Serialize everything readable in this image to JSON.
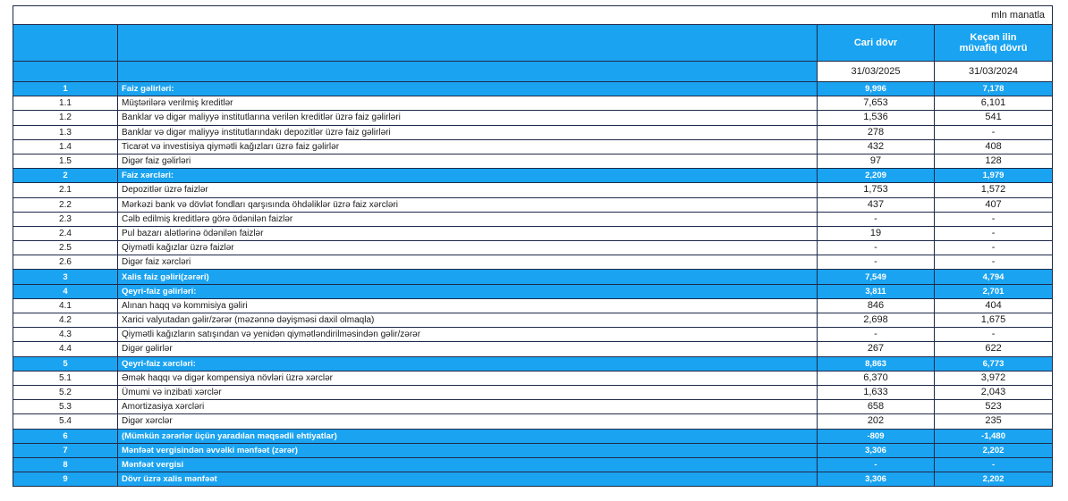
{
  "unit_label": "mln manatla",
  "columns": {
    "current": "Cari dövr",
    "previous_line1": "Keçən ilin",
    "previous_line2": "müvafiq dövrü"
  },
  "dates": {
    "current": "31/03/2025",
    "previous": "31/03/2024"
  },
  "rows": [
    {
      "num": "1",
      "label": "Faiz gəlirləri:",
      "cur": "9,996",
      "prev": "7,178",
      "section": true
    },
    {
      "num": "1.1",
      "label": "Müştərilərə verilmiş kreditlər",
      "cur": "7,653",
      "prev": "6,101",
      "section": false
    },
    {
      "num": "1.2",
      "label": "Banklar və digər maliyyə institutlarına verilən kreditlər üzrə faiz gəlirləri",
      "cur": "1,536",
      "prev": "541",
      "section": false
    },
    {
      "num": "1.3",
      "label": "Banklar və digər maliyyə institutlarındakı depozitlər üzrə faiz gəlirləri",
      "cur": "278",
      "prev": "-",
      "section": false
    },
    {
      "num": "1.4",
      "label": "Ticarət və investisiya qiymətli kağızları üzrə faiz gəlirlər",
      "cur": "432",
      "prev": "408",
      "section": false
    },
    {
      "num": "1.5",
      "label": "Digər faiz gəlirləri",
      "cur": "97",
      "prev": "128",
      "section": false
    },
    {
      "num": "2",
      "label": "Faiz xərcləri:",
      "cur": "2,209",
      "prev": "1,979",
      "section": true
    },
    {
      "num": "2.1",
      "label": "Depozitlər üzrə faizlər",
      "cur": "1,753",
      "prev": "1,572",
      "section": false
    },
    {
      "num": "2.2",
      "label": "Mərkəzi bank və dövlət fondları qarşısında öhdəliklər üzrə faiz xərcləri",
      "cur": "437",
      "prev": "407",
      "section": false
    },
    {
      "num": "2.3",
      "label": "Cəlb edilmiş kreditlərə görə ödənilən faizlər",
      "cur": "-",
      "prev": "-",
      "section": false
    },
    {
      "num": "2.4",
      "label": "Pul bazarı alətlərinə ödənilən faizlər",
      "cur": "19",
      "prev": "-",
      "section": false
    },
    {
      "num": "2.5",
      "label": "Qiymətli kağızlar üzrə faizlər",
      "cur": "-",
      "prev": "-",
      "section": false
    },
    {
      "num": "2.6",
      "label": "Digər faiz xərcləri",
      "cur": "-",
      "prev": "-",
      "section": false
    },
    {
      "num": "3",
      "label": "Xalis faiz gəliri(zərəri)",
      "cur": "7,549",
      "prev": "4,794",
      "section": true
    },
    {
      "num": "4",
      "label": "Qeyri-faiz gəlirləri:",
      "cur": "3,811",
      "prev": "2,701",
      "section": true
    },
    {
      "num": "4.1",
      "label": "Alınan haqq və kommisiya gəliri",
      "cur": "846",
      "prev": "404",
      "section": false
    },
    {
      "num": "4.2",
      "label": "Xarici valyutadan gəlir/zərər (məzənnə dəyişməsi daxil olmaqla)",
      "cur": "2,698",
      "prev": "1,675",
      "section": false
    },
    {
      "num": "4.3",
      "label": "Qiymətli kağızların satışından və yenidən qiymətləndirilməsindən gəlir/zərər",
      "cur": "-",
      "prev": "-",
      "section": false
    },
    {
      "num": "4.4",
      "label": "Digər gəlirlər",
      "cur": "267",
      "prev": "622",
      "section": false
    },
    {
      "num": "5",
      "label": "Qeyri-faiz xərcləri:",
      "cur": "8,863",
      "prev": "6,773",
      "section": true
    },
    {
      "num": "5.1",
      "label": "Əmək haqqı və digər kompensiya növləri üzrə xərclər",
      "cur": "6,370",
      "prev": "3,972",
      "section": false
    },
    {
      "num": "5.2",
      "label": "Ümumi və inzibati xərclər",
      "cur": "1,633",
      "prev": "2,043",
      "section": false
    },
    {
      "num": "5.3",
      "label": "Amortizasiya xərcləri",
      "cur": "658",
      "prev": "523",
      "section": false
    },
    {
      "num": "5.4",
      "label": "Digər xərclər",
      "cur": "202",
      "prev": "235",
      "section": false
    },
    {
      "num": "6",
      "label": "(Mümkün zərərlər üçün yaradılan məqsədli ehtiyatlar)",
      "cur": "-809",
      "prev": "-1,480",
      "section": true
    },
    {
      "num": "7",
      "label": "Mənfəət vergisindən əvvəlki mənfəət (zərər)",
      "cur": "3,306",
      "prev": "2,202",
      "section": true
    },
    {
      "num": "8",
      "label": "Mənfəət vergisi",
      "cur": "-",
      "prev": "-",
      "section": true
    },
    {
      "num": "9",
      "label": "Dövr üzrə xalis mənfəət",
      "cur": "3,306",
      "prev": "2,202",
      "section": true
    }
  ]
}
